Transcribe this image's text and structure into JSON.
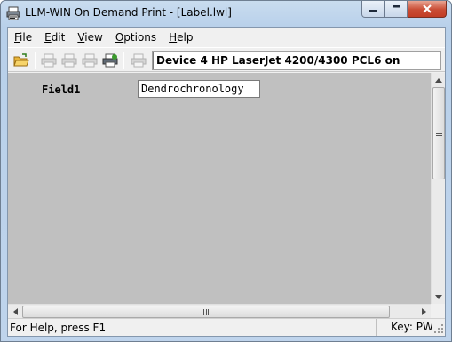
{
  "window": {
    "title": "LLM-WIN On Demand Print - [Label.lwl]",
    "app_icon": "printer-app-icon",
    "accent": "#c23e26"
  },
  "menu": [
    {
      "label": "File",
      "underline": "F",
      "rest": "ile"
    },
    {
      "label": "Edit",
      "underline": "E",
      "rest": "dit"
    },
    {
      "label": "View",
      "underline": "V",
      "rest": "iew"
    },
    {
      "label": "Options",
      "underline": "O",
      "rest": "ptions"
    },
    {
      "label": "Help",
      "underline": "H",
      "rest": "elp"
    }
  ],
  "toolbar": {
    "icons": [
      "open-folder-icon",
      "print-icon",
      "print-preview-icon",
      "print-setup-icon",
      "print-batch-icon",
      "printer-icon"
    ],
    "device": "Device 4 HP LaserJet 4200/4300 PCL6 on"
  },
  "form": {
    "field_label": "Field1",
    "field_value": "Dendrochronology"
  },
  "status": {
    "help": "For Help, press F1",
    "key": "Key: PW-"
  }
}
